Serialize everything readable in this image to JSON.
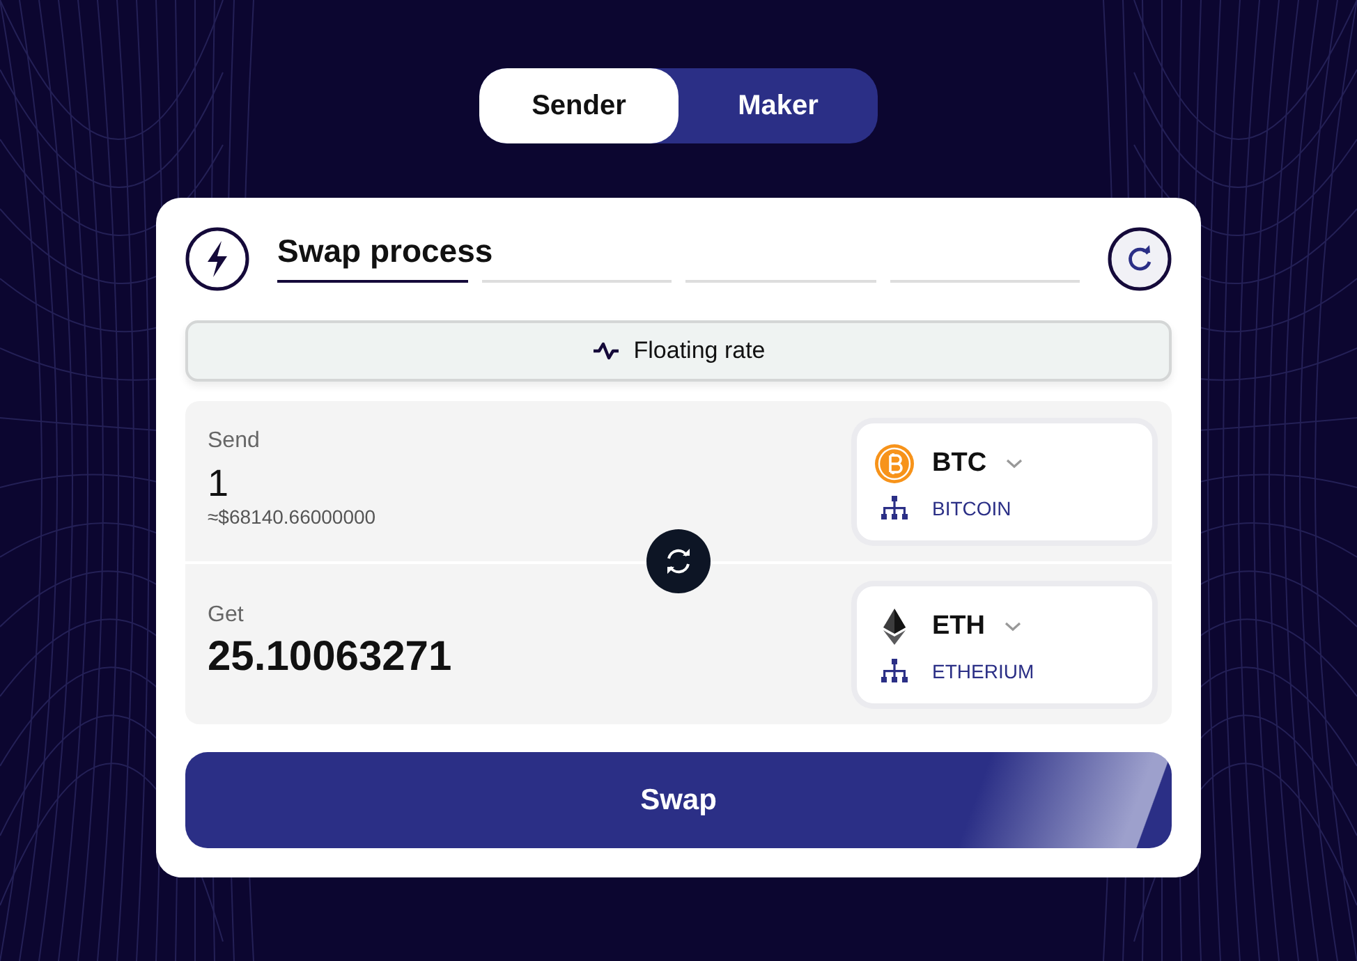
{
  "mode_tabs": [
    {
      "label": "Sender",
      "selected": true
    },
    {
      "label": "Maker",
      "selected": false
    }
  ],
  "card": {
    "title": "Swap process",
    "steps": [
      {
        "active": true
      },
      {
        "active": false
      },
      {
        "active": false
      },
      {
        "active": false
      }
    ],
    "rate_label": "Floating rate",
    "rows": [
      {
        "label": "Send",
        "amount": "1",
        "usd": "≈$68140.66000000",
        "coin": {
          "kind": "btc",
          "symbol": "BTC",
          "network": "BITCOIN"
        }
      },
      {
        "label": "Get",
        "amount": "25.10063271",
        "coin": {
          "kind": "eth",
          "symbol": "ETH",
          "network": "ETHERIUM"
        }
      }
    ],
    "swap_button": "Swap"
  }
}
